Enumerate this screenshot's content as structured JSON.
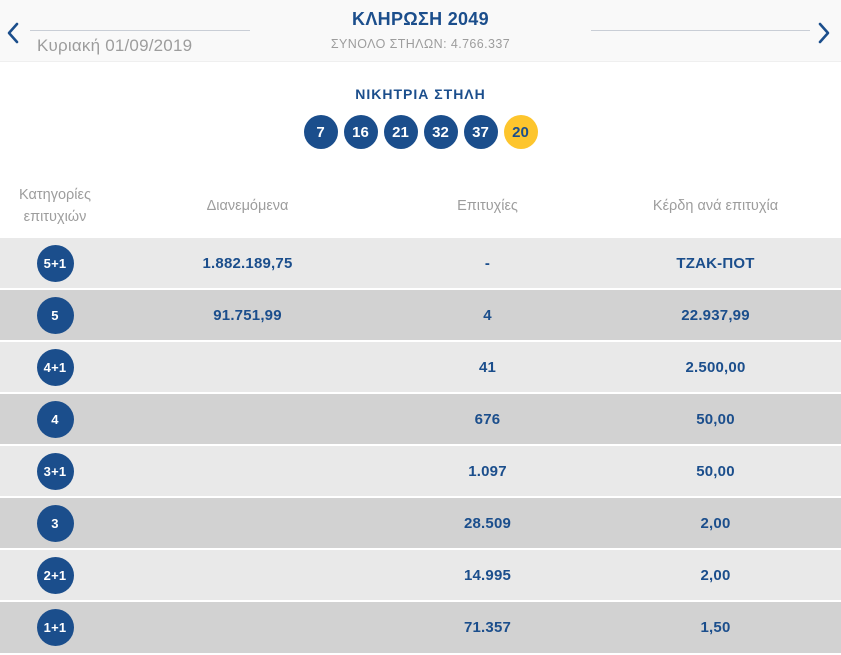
{
  "header": {
    "date": "Κυριακή 01/09/2019",
    "title": "ΚΛΗΡΩΣΗ 2049",
    "total_columns_label": "ΣΥΝΟΛΟ ΣΤΗΛΩΝ:",
    "total_columns_value": "4.766.337"
  },
  "winning_column": {
    "title": "ΝΙΚΗΤΡΙΑ ΣΤΗΛΗ",
    "numbers": [
      "7",
      "16",
      "21",
      "32",
      "37"
    ],
    "joker_number": "20"
  },
  "results_table": {
    "columns": {
      "categories": "Κατηγορίες επιτυχιών",
      "distributed": "Διανεμόμενα",
      "winners": "Επιτυχίες",
      "prize_per_win": "Κέρδη ανά επιτυχία"
    },
    "rows": [
      {
        "category": "5+1",
        "distributed": "1.882.189,75",
        "winners": "-",
        "prize": "ΤΖΑΚ-ΠΟΤ"
      },
      {
        "category": "5",
        "distributed": "91.751,99",
        "winners": "4",
        "prize": "22.937,99"
      },
      {
        "category": "4+1",
        "distributed": "",
        "winners": "41",
        "prize": "2.500,00"
      },
      {
        "category": "4",
        "distributed": "",
        "winners": "676",
        "prize": "50,00"
      },
      {
        "category": "3+1",
        "distributed": "",
        "winners": "1.097",
        "prize": "50,00"
      },
      {
        "category": "3",
        "distributed": "",
        "winners": "28.509",
        "prize": "2,00"
      },
      {
        "category": "2+1",
        "distributed": "",
        "winners": "14.995",
        "prize": "2,00"
      },
      {
        "category": "1+1",
        "distributed": "",
        "winners": "71.357",
        "prize": "1,50"
      }
    ]
  },
  "icons": {
    "prev": "chevron-left",
    "next": "chevron-right"
  },
  "colors": {
    "primary_blue": "#1b4e8c",
    "joker_yellow": "#fdc52d",
    "row_light": "#e9e9e9",
    "row_dark": "#d2d2d2",
    "muted_text": "#9d9d9d"
  }
}
